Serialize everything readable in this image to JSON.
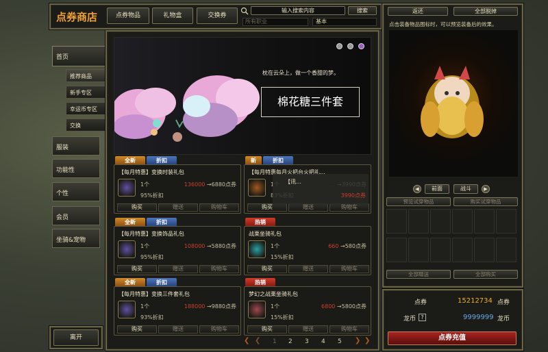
{
  "shop_title": "点券商店",
  "top_tabs": [
    "点券物品",
    "礼物盒",
    "交换券"
  ],
  "search": {
    "placeholder": "输入搜索内容",
    "button": "搜索",
    "job_filter": "所有职业",
    "sort": "基本"
  },
  "nav": {
    "main": "首页",
    "sub": [
      "推荐商品",
      "新手专区",
      "幸运币专区",
      "交换"
    ],
    "categories": [
      "服装",
      "功能性",
      "个性",
      "会员",
      "坐骑&宠物"
    ],
    "exit": "离开"
  },
  "banner": {
    "tagline": "枕在云朵上，做一个香甜的梦。",
    "title": "棉花糖三件套"
  },
  "products": [
    {
      "tags": [
        "全新",
        "折扣"
      ],
      "name": "【每月特惠】变换时装礼包",
      "qty": "1个",
      "old_price": "136000",
      "price": "6880点券",
      "discount": "95%折扣",
      "buy": "购买",
      "gift": "赠送",
      "cart": "购物车"
    },
    {
      "tags": [
        "新",
        "折扣"
      ],
      "name": "【每月特惠每月火把台火把礼…",
      "qty": "1个",
      "old_price": "…",
      "price": "3990点券",
      "discount": "83%折扣",
      "buy": "购买",
      "gift": "赠送",
      "cart": "购物车",
      "overlay": "【讯…",
      "overlay_price": "3990点券"
    },
    {
      "tags": [
        "全新",
        "折扣"
      ],
      "name": "【每月特惠】变换饰品礼包",
      "qty": "1个",
      "old_price": "108000",
      "price": "5880点券",
      "discount": "95%折扣",
      "buy": "购买",
      "gift": "赠送",
      "cart": "购物车"
    },
    {
      "tags": [
        "热销"
      ],
      "name": "战栗坐骑礼包",
      "qty": "1个",
      "old_price": "660",
      "price": "580点券",
      "discount": "15%折扣",
      "buy": "购买",
      "gift": "赠送",
      "cart": "购物车"
    },
    {
      "tags": [
        "全新",
        "折扣"
      ],
      "name": "【每月特惠】变换三件套礼包",
      "qty": "1个",
      "old_price": "188000",
      "price": "9880点券",
      "discount": "93%折扣",
      "buy": "购买",
      "gift": "赠送",
      "cart": "购物车"
    },
    {
      "tags": [
        "热销"
      ],
      "name": "梦幻之战栗坐骑礼包",
      "qty": "1个",
      "old_price": "6800",
      "price": "5800点券",
      "discount": "15%折扣",
      "buy": "购买",
      "gift": "赠送",
      "cart": "购物车"
    }
  ],
  "pagination": [
    "1",
    "2",
    "3",
    "4",
    "5"
  ],
  "preview": {
    "back": "返还",
    "remove_all": "全部脱掉",
    "hint": "点击装备物品图标时，可以预览装备后的效果。",
    "front": "前面",
    "battle": "战斗",
    "try_item": "预览试穿物品",
    "buy_try": "购买试穿物品",
    "gift_all": "全部赠送",
    "buy_all": "全部购买"
  },
  "currency": {
    "points_label": "点券",
    "points_value": "15212734",
    "points_unit": "点券",
    "dragon_label": "龙币",
    "dragon_help": "?",
    "dragon_value": "9999999",
    "dragon_unit": "龙币",
    "recharge": "点券充值"
  },
  "colors": {
    "accent": "#f0a030",
    "points": "#f0b020",
    "dragon": "#6aa8e8",
    "recharge": "#8a1a18"
  }
}
